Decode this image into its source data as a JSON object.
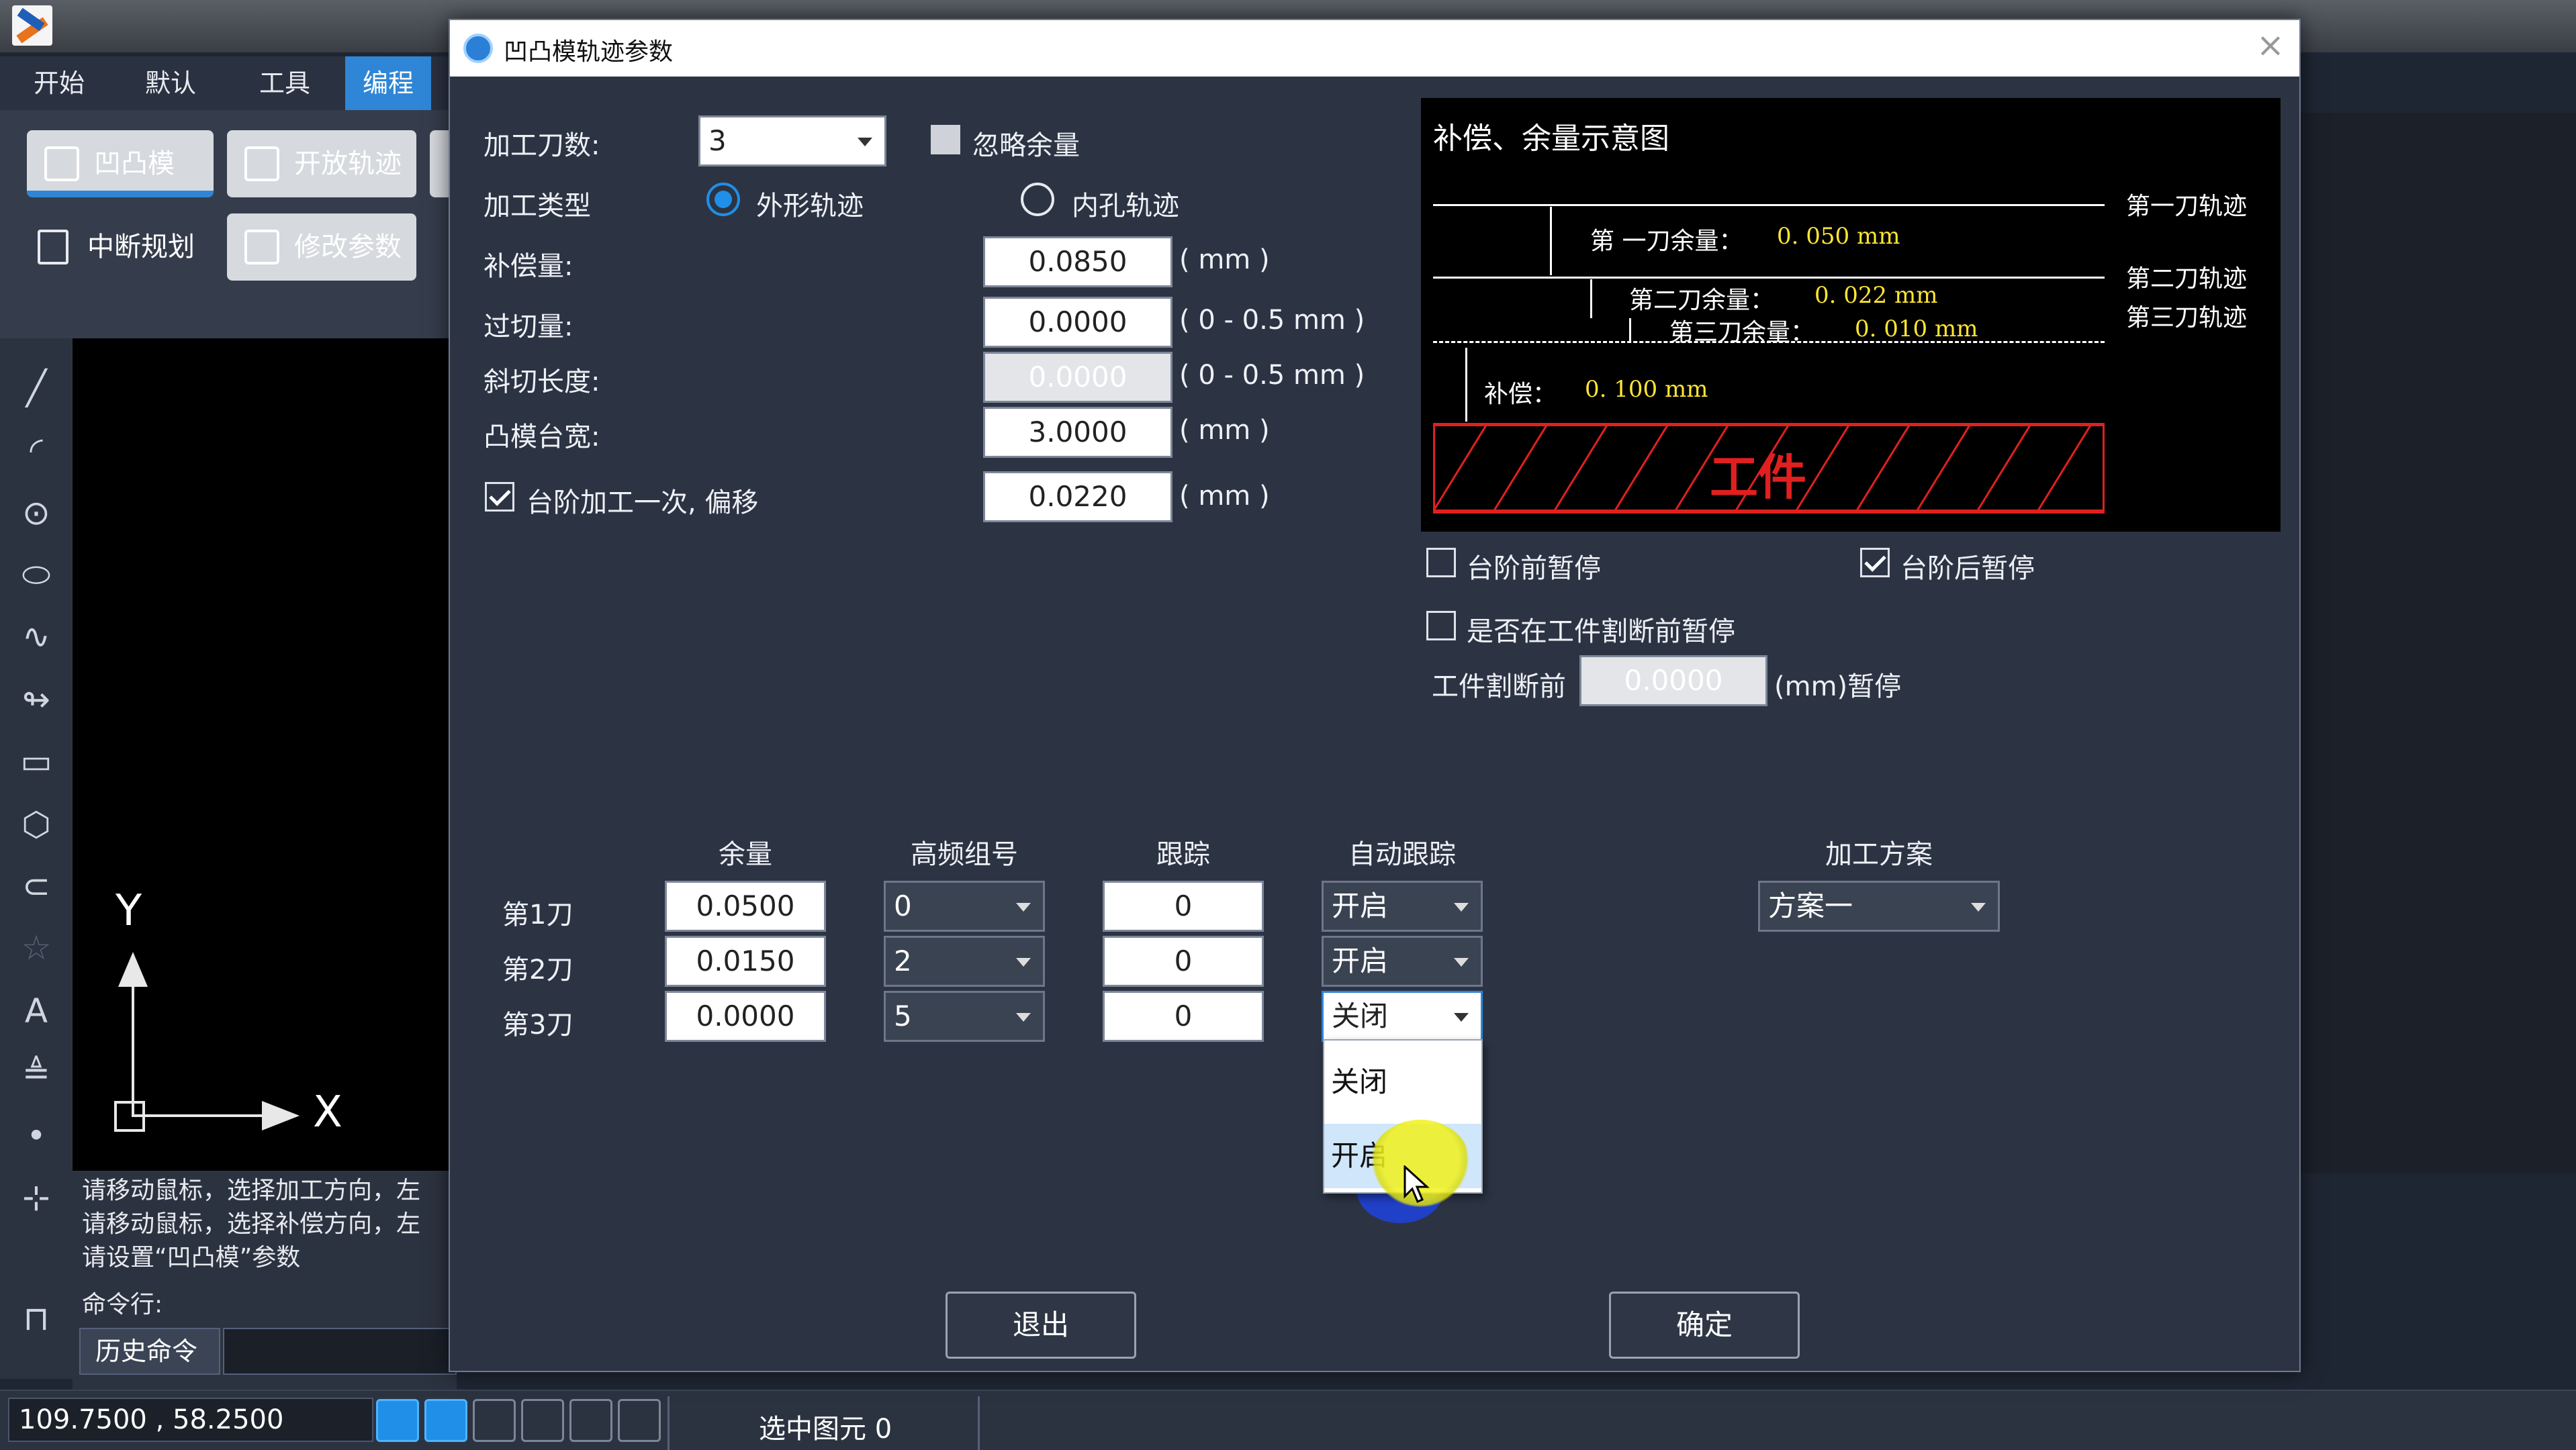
{
  "app": {
    "menu": [
      "开始",
      "默认",
      "工具",
      "编程"
    ],
    "active_menu": "编程",
    "ribbon": {
      "die_button": "凹凸模",
      "open_path_button": "开放轨迹",
      "interrupt_button": "中断规划",
      "modify_button": "修改参数"
    },
    "axis": {
      "x": "X",
      "y": "Y"
    },
    "command_log": [
      "请移动鼠标，选择加工方向，左",
      "请移动鼠标，选择补偿方向，左",
      "请设置“凹凸模”参数"
    ],
    "command_label": "命令行:",
    "history_button": "历史命令",
    "status": {
      "coords": "109.7500 , 58.2500",
      "selected": "选中图元 0"
    }
  },
  "dialog": {
    "title": "凹凸模轨迹参数",
    "close": "×",
    "tool_count_label": "加工刀数:",
    "tool_count_value": "3",
    "ignore_allowance_label": "忽略余量",
    "type_label": "加工类型",
    "outer_label": "外形轨迹",
    "inner_label": "内孔轨迹",
    "compensation_label": "补偿量:",
    "compensation_value": "0.0850",
    "compensation_unit": "( mm )",
    "overcut_label": "过切量:",
    "overcut_value": "0.0000",
    "overcut_unit": "( 0 - 0.5 mm )",
    "bevel_label": "斜切长度:",
    "bevel_value": "0.0000",
    "bevel_unit": "( 0 - 0.5 mm )",
    "platform_label": "凸模台宽:",
    "platform_value": "3.0000",
    "platform_unit": "( mm )",
    "step_label": "台阶加工一次, 偏移",
    "step_value": "0.0220",
    "step_unit": "( mm )",
    "diagram": {
      "title": "补偿、余量示意图",
      "first_path": "第一刀轨迹",
      "second_path": "第二刀轨迹",
      "third_path": "第三刀轨迹",
      "first_allow": "第 一刀余量：",
      "first_allow_val": "0. 050  mm",
      "second_allow": "第二刀余量：",
      "second_allow_val": "0. 022  mm",
      "third_allow": "第三刀余量：",
      "third_allow_val": "0. 010  mm",
      "comp": "补偿：",
      "comp_val": "0. 100  mm",
      "workpiece": "工件"
    },
    "pause_before_step": "台阶前暂停",
    "pause_after_step": "台阶后暂停",
    "pause_before_cut": "是否在工件割断前暂停",
    "cut_before_label": "工件割断前",
    "cut_before_value": "0.0000",
    "cut_before_unit": "(mm)暂停",
    "table": {
      "headers": [
        "余量",
        "高频组号",
        "跟踪",
        "自动跟踪"
      ],
      "rows": [
        {
          "name": "第1刀",
          "allowance": "0.0500",
          "group": "0",
          "track": "0",
          "auto": "开启"
        },
        {
          "name": "第2刀",
          "allowance": "0.0150",
          "group": "2",
          "track": "0",
          "auto": "开启"
        },
        {
          "name": "第3刀",
          "allowance": "0.0000",
          "group": "5",
          "track": "0",
          "auto": "关闭"
        }
      ]
    },
    "plan_label": "加工方案",
    "plan_value": "方案一",
    "dropdown_options": [
      "关闭",
      "开启"
    ],
    "exit_button": "退出",
    "ok_button": "确定",
    "colors": {
      "accent": "#1f8fe8",
      "diagram_red": "#e02020",
      "diagram_yellow": "#ffe633"
    }
  }
}
